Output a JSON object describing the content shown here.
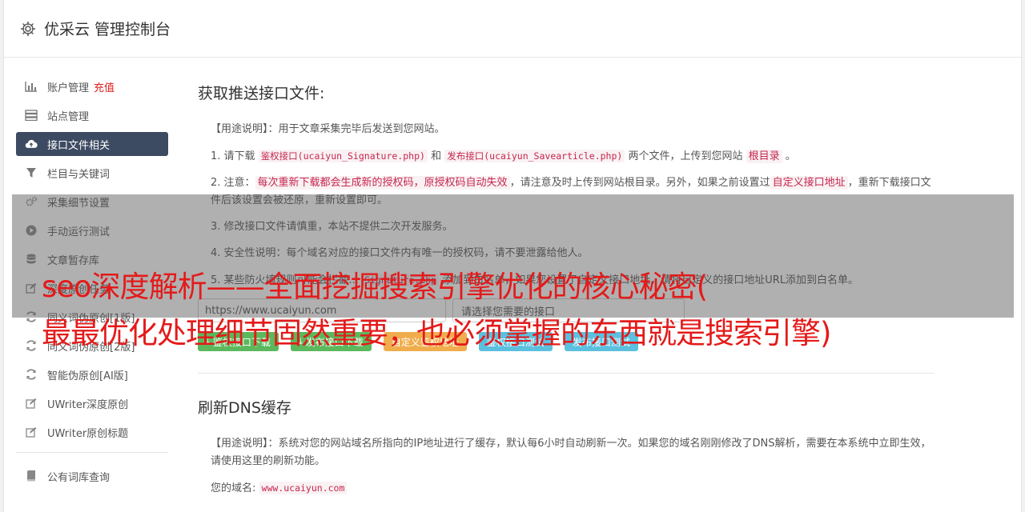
{
  "header": {
    "title": "优采云 管理控制台"
  },
  "sidebar": {
    "items": [
      {
        "label": "账户管理",
        "extra": "充值",
        "icon": "bar-chart-icon"
      },
      {
        "label": "站点管理",
        "icon": "server-icon"
      },
      {
        "label": "接口文件相关",
        "icon": "cloud-upload-icon",
        "active": true
      },
      {
        "label": "栏目与关键词",
        "icon": "filter-icon"
      },
      {
        "label": "采集细节设置",
        "icon": "cogs-icon"
      },
      {
        "label": "手动运行测试",
        "icon": "play-icon"
      },
      {
        "label": "文章暂存库",
        "icon": "database-icon"
      },
      {
        "label": "深度原创任务",
        "icon": "edit-icon"
      },
      {
        "label": "同义词伪原创[1版]",
        "icon": "refresh-icon"
      },
      {
        "label": "同义词伪原创[2版]",
        "icon": "refresh-icon"
      },
      {
        "label": "智能伪原创[AI版]",
        "icon": "refresh-icon"
      },
      {
        "label": "UWriter深度原创",
        "icon": "edit-icon"
      },
      {
        "label": "UWriter原创标题",
        "icon": "edit-icon"
      },
      {
        "label": "公有词库查询",
        "icon": "book-icon"
      }
    ]
  },
  "section1": {
    "title": "获取推送接口文件:",
    "usage_label": "【用途说明】",
    "usage_text": "：用于文章采集完毕后发送到您网站。",
    "step1": {
      "prefix": "1. 请下载",
      "code1": "鉴权接口(ucaiyun_Signature.php)",
      "and": "和",
      "code2": "发布接口(ucaiyun_Savearticle.php)",
      "mid": "两个文件，上传到您网站",
      "code3": "根目录",
      "end": "。"
    },
    "step2": {
      "prefix": "2. 注意：",
      "hl1": "每次重新下载都会生成新的授权码，原授权码自动失效",
      "mid": "，请注意及时上传到网站根目录。另外，如果之前设置过",
      "hl2": "自定义接口地址",
      "end": "，重新下载接口文件后该设置会被还原，重新设置即可。"
    },
    "step3": "3. 修改接口文件请慎重，本站不提供二次开发服务。",
    "step4": "4. 安全性说明：每个域名对应的接口文件内有唯一的授权码，请不要泄露给他人。",
    "step5": {
      "prefix": "5. 某些防火墙规则可能会拦截...",
      "code": "Signature.php",
      "end": "添加到白名单，如果您设置了自定义接口地址，请将自定义的接口地址URL添加到白名单。"
    },
    "url_input": "https://www.ucaiyun.com",
    "select_placeholder": "请选择您需要的接口",
    "buttons": {
      "sig_download": "鉴权接口下载",
      "pub_download": "发布接口下载",
      "custom_sig": "自定义鉴权地址",
      "sig_test": "鉴权接口测试",
      "pub_test": "发布接口测试"
    }
  },
  "section2": {
    "title": "刷新DNS缓存",
    "usage_label": "【用途说明】",
    "usage_text": "：系统对您的网站域名所指向的IP地址进行了缓存，默认每6小时自动刷新一次。如果您的域名刚刚修改了DNS解析，需要在本系统中立即生效，请使用这里的刷新功能。",
    "domain_label": "您的域名:",
    "domain_value": "www.ucaiyun.com"
  },
  "overlay": {
    "line1": "seo深度解析——全面挖掘搜索引擎优化的核心秘密(",
    "line2": "最最优化处理细节固然重要，也必须掌握的东西就是搜索引擎)"
  },
  "colors": {
    "active_bg": "#3c4a62",
    "green": "#5cb85c",
    "orange": "#f0ad4e",
    "blue": "#5bc0de",
    "red": "#e41a1a"
  }
}
